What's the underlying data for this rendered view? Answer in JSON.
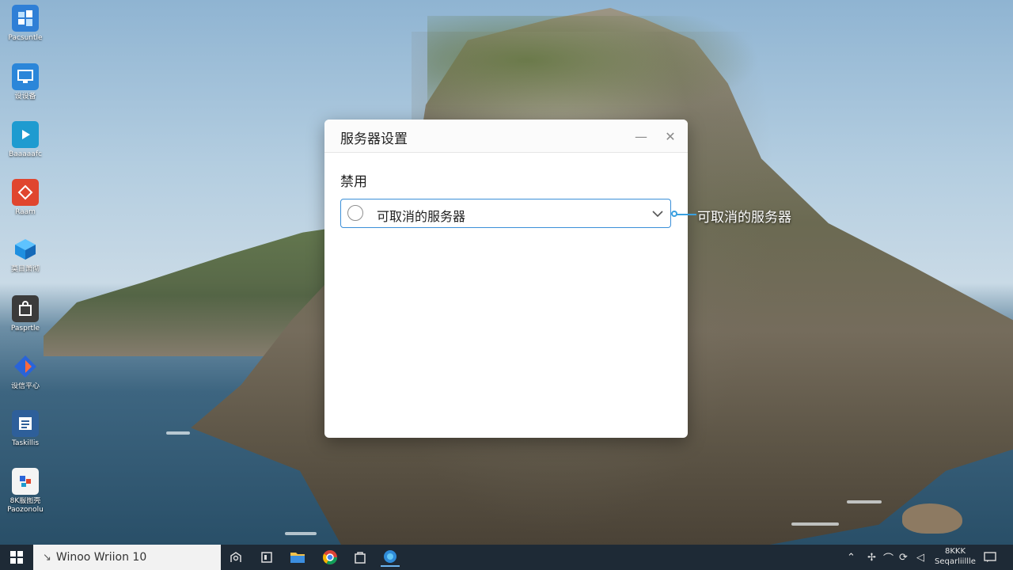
{
  "desktop": {
    "icons": [
      {
        "label": "Pacsuntle",
        "icon": "windows-tiles-icon",
        "color": "#2f7fd6"
      },
      {
        "label": "设设备",
        "icon": "monitor-icon",
        "color": "#2b86d9"
      },
      {
        "label": "Baaaaafc",
        "icon": "media-player-icon",
        "color": "#1e9bd0"
      },
      {
        "label": "Raam",
        "icon": "red-app-icon",
        "color": "#e0462f"
      },
      {
        "label": "莫目萧彻",
        "icon": "cube-icon",
        "color": "#1e8fe0"
      },
      {
        "label": "Pasprtle",
        "icon": "shopping-bag-icon",
        "color": "#3b3b3b"
      },
      {
        "label": "设信平心",
        "icon": "diamond-app-icon",
        "color": "#2a64d8"
      },
      {
        "label": "Taskillis",
        "icon": "document-list-icon",
        "color": "#2e5f9a"
      },
      {
        "label": "8K服图壳\nPaozonolu",
        "icon": "colorful-app-icon",
        "color": "#f4f4f4"
      }
    ]
  },
  "dialog": {
    "title": "服务器设置",
    "minimize_glyph": "—",
    "close_glyph": "✕",
    "section_label": "禁用",
    "combo_value": "可取消的服务器"
  },
  "callout": {
    "text": "可取消的服务器",
    "color": "#3aa0e0"
  },
  "taskbar": {
    "search_text": "Winoo Wriion 10",
    "clock_line1": "8KKK",
    "clock_line2": "Seqarliillle",
    "accent": "#6cb4ee"
  }
}
